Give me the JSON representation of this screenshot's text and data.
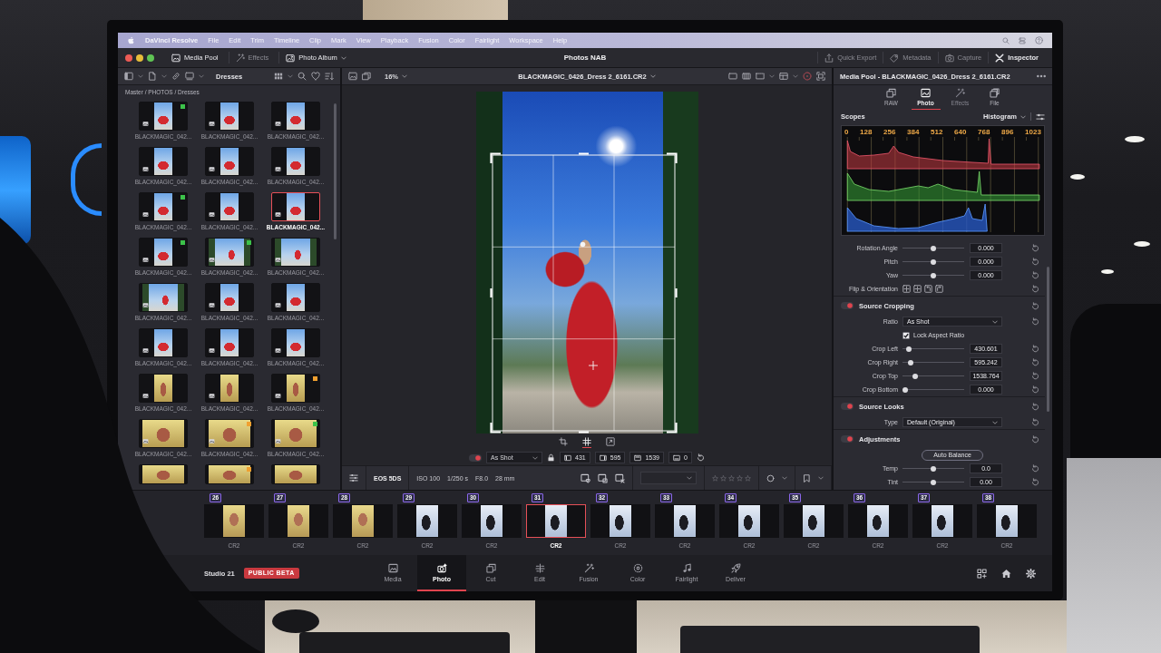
{
  "menu_bar": {
    "app": "DaVinci Resolve",
    "items": [
      "File",
      "Edit",
      "Trim",
      "Timeline",
      "Clip",
      "Mark",
      "View",
      "Playback",
      "Fusion",
      "Color",
      "Fairlight",
      "Workspace",
      "Help"
    ]
  },
  "toolbar": {
    "left": [
      {
        "label": "Media Pool",
        "on": true
      },
      {
        "label": "Effects",
        "on": false
      },
      {
        "label": "Photo Album",
        "on": true,
        "dropdown": true
      }
    ],
    "title": "Photos NAB",
    "right": [
      {
        "label": "Quick Export",
        "on": false
      },
      {
        "label": "Metadata",
        "on": false
      },
      {
        "label": "Capture",
        "on": false
      },
      {
        "label": "Inspector",
        "on": true
      }
    ]
  },
  "media_pool": {
    "bin": "Dresses",
    "path": "Master / PHOTOS / Dresses",
    "items": [
      {
        "label": "BLACKMAGIC_042...",
        "kind": "portrait",
        "selected": false,
        "color": "#3cc24a"
      },
      {
        "label": "BLACKMAGIC_042...",
        "kind": "portrait",
        "selected": false
      },
      {
        "label": "BLACKMAGIC_042...",
        "kind": "portrait",
        "selected": false
      },
      {
        "label": "BLACKMAGIC_042...",
        "kind": "portrait",
        "selected": false
      },
      {
        "label": "BLACKMAGIC_042...",
        "kind": "portrait",
        "selected": false
      },
      {
        "label": "BLACKMAGIC_042...",
        "kind": "portrait",
        "selected": false
      },
      {
        "label": "BLACKMAGIC_042...",
        "kind": "portrait",
        "selected": false,
        "color": "#3cc24a"
      },
      {
        "label": "BLACKMAGIC_042...",
        "kind": "portrait",
        "selected": false
      },
      {
        "label": "BLACKMAGIC_042...",
        "kind": "portrait",
        "selected": true
      },
      {
        "label": "BLACKMAGIC_042...",
        "kind": "portrait",
        "selected": false,
        "color": "#3cc24a"
      },
      {
        "label": "BLACKMAGIC_042...",
        "kind": "landscape",
        "selected": false,
        "color": "#3cc24a"
      },
      {
        "label": "BLACKMAGIC_042...",
        "kind": "landscape",
        "selected": false
      },
      {
        "label": "BLACKMAGIC_042...",
        "kind": "landscape",
        "selected": false
      },
      {
        "label": "BLACKMAGIC_042...",
        "kind": "portrait",
        "selected": false
      },
      {
        "label": "BLACKMAGIC_042...",
        "kind": "portrait",
        "selected": false
      },
      {
        "label": "BLACKMAGIC_042...",
        "kind": "portrait",
        "selected": false
      },
      {
        "label": "BLACKMAGIC_042...",
        "kind": "portrait",
        "selected": false
      },
      {
        "label": "BLACKMAGIC_042...",
        "kind": "portrait",
        "selected": false
      },
      {
        "label": "BLACKMAGIC_042...",
        "kind": "portrait",
        "selected": false
      },
      {
        "label": "BLACKMAGIC_042...",
        "kind": "portrait",
        "selected": false
      },
      {
        "label": "BLACKMAGIC_042...",
        "kind": "portrait",
        "selected": false,
        "color": "#f0a030"
      },
      {
        "label": "BLACKMAGIC_042...",
        "kind": "landscape",
        "selected": false
      },
      {
        "label": "BLACKMAGIC_042...",
        "kind": "landscape",
        "selected": false,
        "color": "#f0a030"
      },
      {
        "label": "BLACKMAGIC_042...",
        "kind": "landscape",
        "selected": false,
        "color": "#3cc24a"
      },
      {
        "kind": "landscape",
        "selected": false
      },
      {
        "kind": "landscape",
        "selected": false,
        "color": "#f0a030"
      },
      {
        "kind": "landscape",
        "selected": false
      }
    ]
  },
  "viewer": {
    "zoom": "16%",
    "clip_name": "BLACKMAGIC_0426_Dress 2_6161.CR2",
    "tools": [
      {
        "selected": false
      },
      {
        "selected": true
      },
      {
        "selected": false
      }
    ],
    "crop_bar": {
      "on": true,
      "ratio": "As Shot",
      "locked": true,
      "fields": [
        "431",
        "595",
        "1539",
        "0"
      ]
    },
    "metadata": {
      "camera": "EOS 5DS",
      "fields": [
        "ISO 100",
        "1/250 s",
        "F8.0",
        "28 mm"
      ],
      "stars": 0
    }
  },
  "inspector": {
    "title": "Media Pool - BLACKMAGIC_0426_Dress 2_6161.CR2",
    "tabs": [
      {
        "label": "RAW",
        "selected": false,
        "disabled": false
      },
      {
        "label": "Photo",
        "selected": true,
        "disabled": false
      },
      {
        "label": "Effects",
        "selected": false,
        "disabled": true
      },
      {
        "label": "File",
        "selected": false,
        "disabled": false
      }
    ],
    "scopes": {
      "title": "Scopes",
      "mode": "Histogram",
      "axis_labels": [
        "0",
        "128",
        "256",
        "384",
        "512",
        "640",
        "768",
        "896",
        "1023"
      ]
    },
    "transform": [
      {
        "kind": "slider",
        "label": "Rotation Angle",
        "level": 0.5,
        "value": "0.000"
      },
      {
        "kind": "slider",
        "label": "Pitch",
        "level": 0.5,
        "value": "0.000"
      },
      {
        "kind": "slider",
        "label": "Yaw",
        "level": 0.5,
        "value": "0.000"
      },
      {
        "kind": "flip",
        "label": "Flip & Orientation"
      }
    ],
    "sections": [
      {
        "title": "Source Cropping",
        "on": true,
        "rows": [
          {
            "kind": "dropdown",
            "label": "Ratio",
            "value": "As Shot"
          },
          {
            "kind": "checkbox",
            "label": "Lock Aspect Ratio",
            "checked": true
          },
          {
            "kind": "slider",
            "label": "Crop Left",
            "level": 0.07,
            "value": "430.601"
          },
          {
            "kind": "slider",
            "label": "Crop Right",
            "level": 0.09,
            "value": "595.242"
          },
          {
            "kind": "slider",
            "label": "Crop Top",
            "level": 0.17,
            "value": "1538.764"
          },
          {
            "kind": "slider",
            "label": "Crop Bottom",
            "level": 0,
            "value": "0.000"
          }
        ]
      },
      {
        "title": "Source Looks",
        "on": true,
        "rows": [
          {
            "kind": "dropdown",
            "label": "Type",
            "value": "Default (Original)"
          }
        ]
      },
      {
        "title": "Adjustments",
        "on": true,
        "rows": [
          {
            "kind": "button",
            "label": "Auto Balance"
          },
          {
            "kind": "slider",
            "label": "Temp",
            "level": 0.5,
            "value": "0.0"
          },
          {
            "kind": "slider",
            "label": "Tint",
            "level": 0.5,
            "value": "0.00"
          }
        ]
      }
    ]
  },
  "filmstrip": [
    {
      "number": "26",
      "label": "CR2",
      "selected": false
    },
    {
      "number": "27",
      "label": "CR2",
      "selected": false
    },
    {
      "number": "28",
      "label": "CR2",
      "selected": false
    },
    {
      "number": "29",
      "label": "CR2",
      "selected": false
    },
    {
      "number": "30",
      "label": "CR2",
      "selected": false
    },
    {
      "number": "31",
      "label": "CR2",
      "selected": true
    },
    {
      "number": "32",
      "label": "CR2",
      "selected": false
    },
    {
      "number": "33",
      "label": "CR2",
      "selected": false
    },
    {
      "number": "34",
      "label": "CR2",
      "selected": false
    },
    {
      "number": "35",
      "label": "CR2",
      "selected": false
    },
    {
      "number": "36",
      "label": "CR2",
      "selected": false
    },
    {
      "number": "37",
      "label": "CR2",
      "selected": false
    },
    {
      "number": "38",
      "label": "CR2",
      "selected": false
    }
  ],
  "page_bar": {
    "version": "Studio 21",
    "badge": "PUBLIC BETA",
    "tabs": [
      {
        "label": "Media",
        "selected": false
      },
      {
        "label": "Photo",
        "selected": true
      },
      {
        "label": "Cut",
        "selected": false
      },
      {
        "label": "Edit",
        "selected": false
      },
      {
        "label": "Fusion",
        "selected": false
      },
      {
        "label": "Color",
        "selected": false
      },
      {
        "label": "Fairlight",
        "selected": false
      },
      {
        "label": "Deliver",
        "selected": false
      }
    ]
  }
}
